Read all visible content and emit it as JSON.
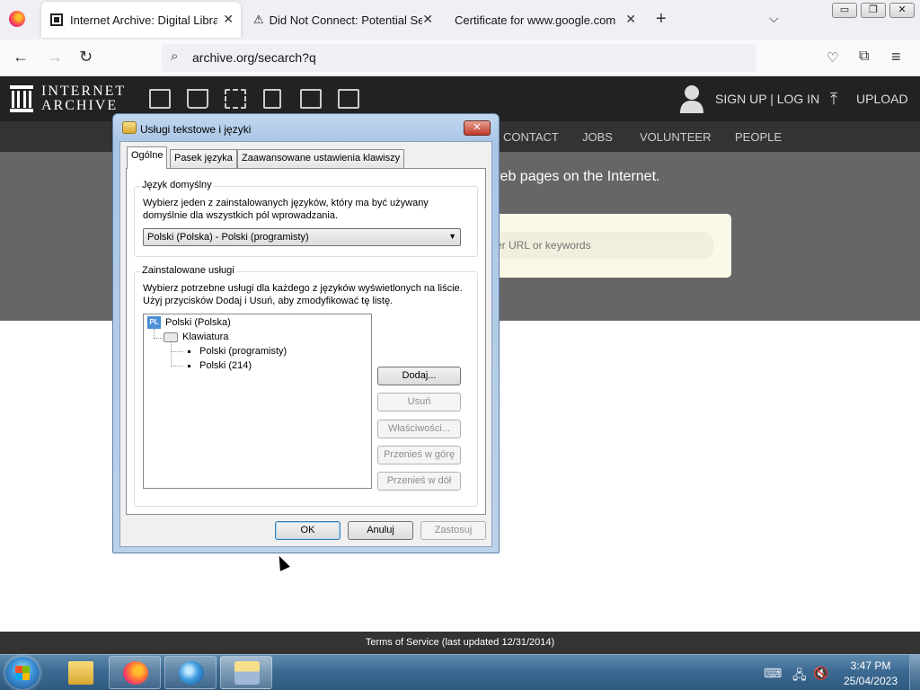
{
  "browser": {
    "tabs": [
      {
        "title": "Internet Archive: Digital Library",
        "active": true
      },
      {
        "title": "Did Not Connect: Potential Sec",
        "active": false
      },
      {
        "title": "Certificate for www.google.com",
        "active": false
      }
    ],
    "tab_close_glyph": "✕",
    "new_tab_glyph": "+",
    "tab_list_glyph": "⌵",
    "window_buttons": {
      "minimize": "▭",
      "maximize": "❐",
      "close": "✕"
    },
    "url": "archive.org/secarch?q",
    "icons": {
      "back": "back-arrow-icon",
      "forward": "forward-arrow-icon",
      "reload": "reload-icon",
      "search": "search-icon",
      "pocket": "pocket-icon",
      "extensions": "extensions-icon",
      "menu": "hamburger-menu-icon"
    }
  },
  "ia": {
    "logo_line1": "INTERNET",
    "logo_line2": "ARCHIVE",
    "signup": "SIGN UP | LOG IN",
    "upload": "UPLOAD",
    "nav": [
      "CONTACT",
      "JOBS",
      "VOLUNTEER",
      "PEOPLE"
    ],
    "tagline": "web pages on the Internet.",
    "search_placeholder": "er URL or keywords",
    "footer": "Terms of Service (last updated 12/31/2014)"
  },
  "dialog": {
    "title": "Usługi tekstowe i języki",
    "close": "✕",
    "tabs": [
      "Ogólne",
      "Pasek języka",
      "Zaawansowane ustawienia klawiszy"
    ],
    "default_lang": {
      "label": "Język domyślny",
      "desc_line1": "Wybierz jeden z zainstalowanych języków, który ma być używany",
      "desc_line2": "domyślnie dla wszystkich pól wprowadzania.",
      "selected": "Polski (Polska) - Polski (programisty)"
    },
    "installed": {
      "label": "Zainstalowane usługi",
      "desc_line1": "Wybierz potrzebne usługi dla każdego z języków wyświetlonych na liście.",
      "desc_line2": "Użyj przycisków Dodaj i Usuń, aby zmodyfikować tę listę.",
      "lang_badge": "PL",
      "lang": "Polski (Polska)",
      "category": "Klawiatura",
      "items": [
        "Polski (programisty)",
        "Polski (214)"
      ]
    },
    "buttons": {
      "add": "Dodaj...",
      "remove": "Usuń",
      "properties": "Właściwości...",
      "move_up": "Przenieś w górę",
      "move_down": "Przenieś w dół",
      "ok": "OK",
      "cancel": "Anuluj",
      "apply": "Zastosuj"
    }
  },
  "taskbar": {
    "time": "3:47 PM",
    "date": "25/04/2023"
  }
}
